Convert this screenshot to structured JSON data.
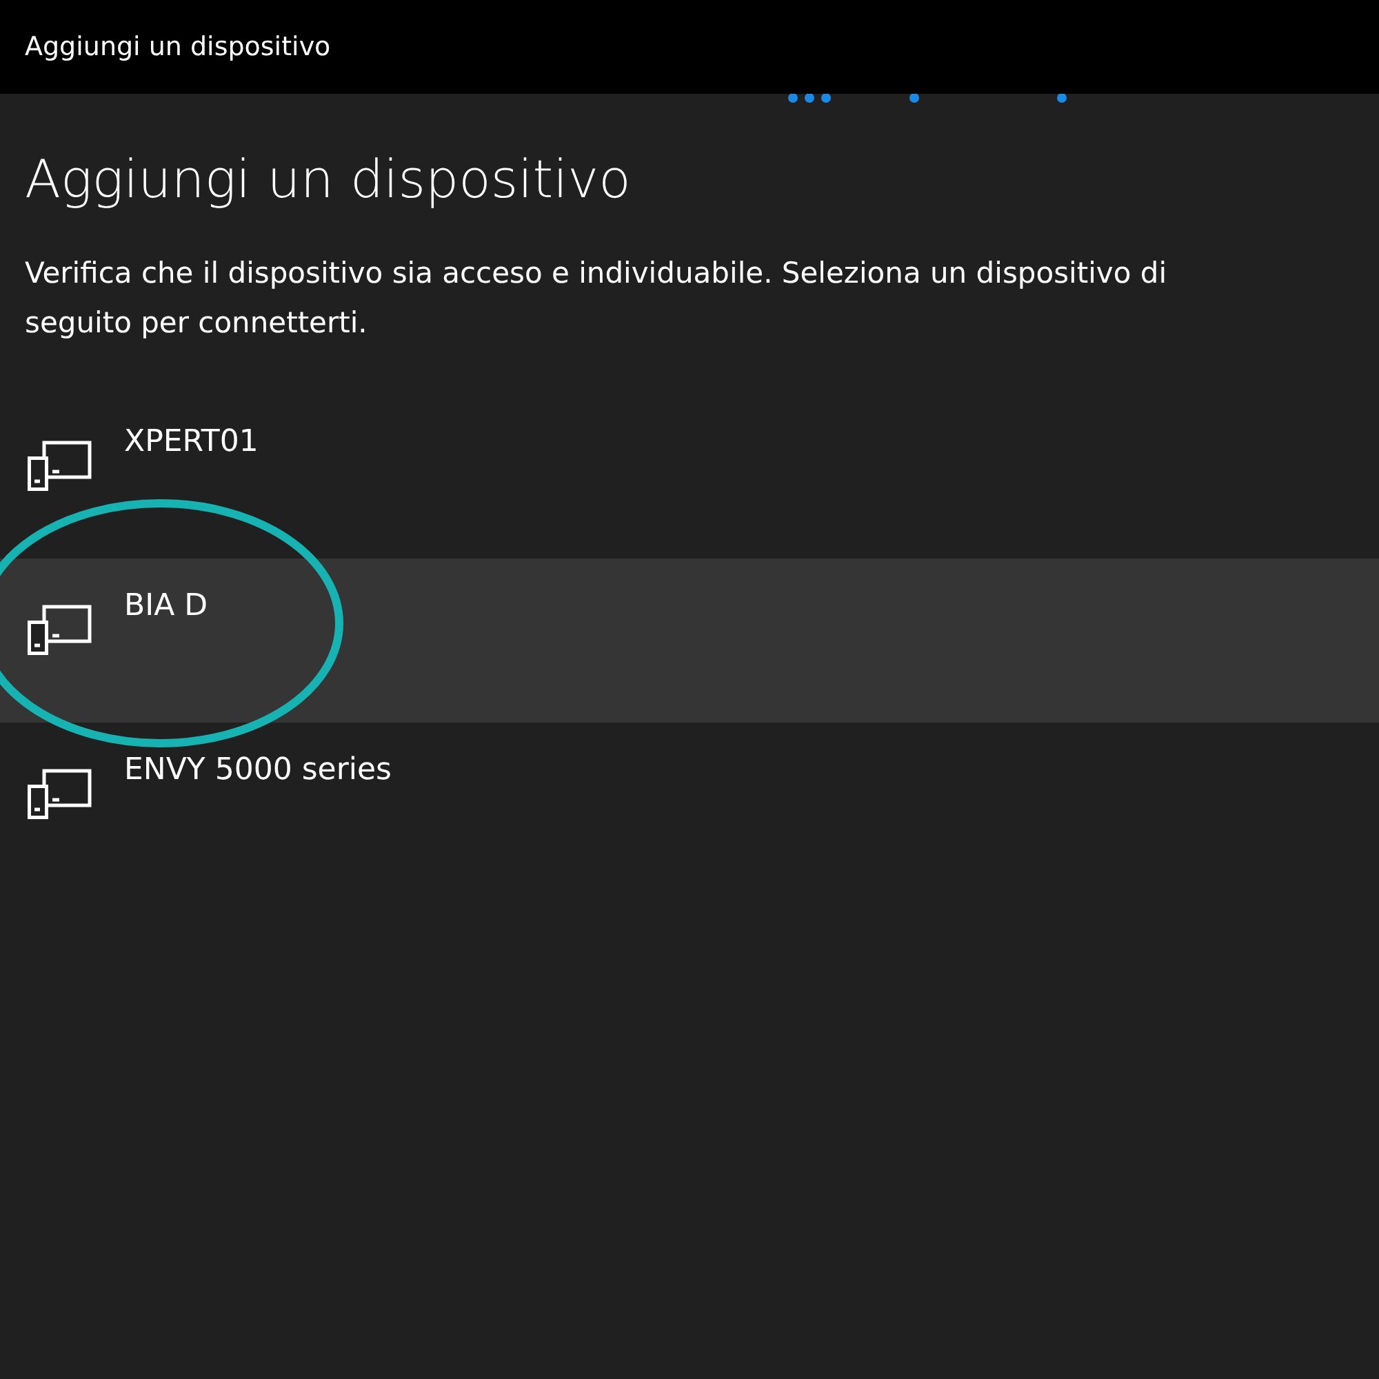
{
  "window": {
    "title": "Aggiungi un dispositivo"
  },
  "heading": "Aggiungi un dispositivo",
  "description": "Verifica che il dispositivo sia acceso e individuabile. Seleziona un dispositivo di seguito per connetterti.",
  "devices": [
    {
      "name": "XPERT01",
      "selected": false
    },
    {
      "name": "BIA D",
      "selected": true
    },
    {
      "name": "ENVY 5000 series",
      "selected": false
    }
  ]
}
